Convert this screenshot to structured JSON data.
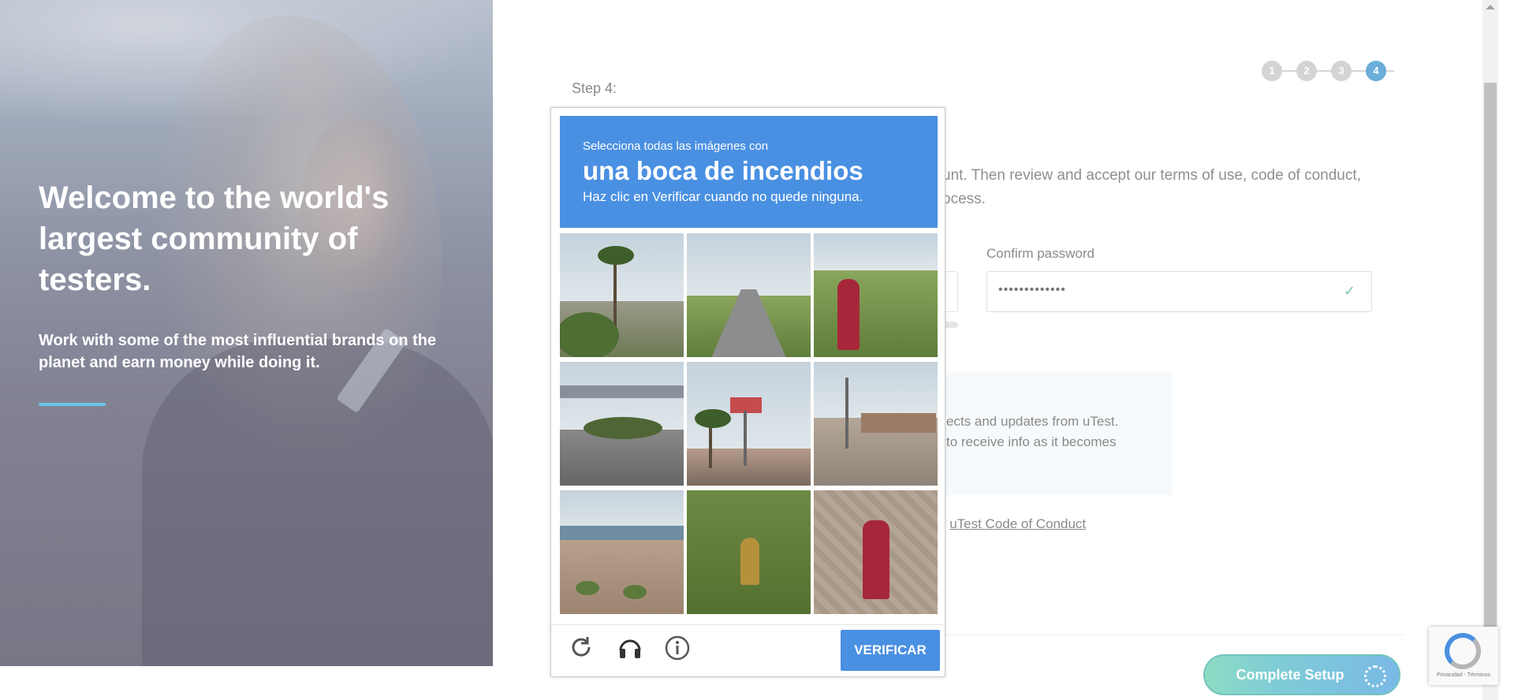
{
  "hero": {
    "heading": "Welcome to the world's largest community of testers.",
    "subtext": "Work with some of the most influential brands on the planet and earn money while doing it."
  },
  "form": {
    "step_label": "Step 4:",
    "steps": [
      "1",
      "2",
      "3",
      "4"
    ],
    "active_step": "4",
    "intro_line1": "unt. Then review and accept our terms of use, code of conduct,",
    "intro_line2": "ocess.",
    "confirm_password_label": "Confirm password",
    "confirm_password_value": "•••••••••••••",
    "newsletter_line1": "ects and updates from uTest.",
    "newsletter_line2": "to receive info as it becomes",
    "conduct_prefix": "e ",
    "conduct_link": "uTest Code of Conduct",
    "complete_button": "Complete Setup"
  },
  "captcha": {
    "instruction_small": "Selecciona todas las imágenes con",
    "instruction_target": "una boca de incendios",
    "instruction_hint": "Haz clic en Verificar cuando no quede ninguna.",
    "tiles": [
      "palm-tree",
      "highway",
      "fire-hydrant",
      "overpass",
      "palm-sign",
      "street-corner",
      "bridge-shrubs",
      "fire-hydrant-field",
      "fire-hydrant-pavement"
    ],
    "reload_icon": "reload-icon",
    "audio_icon": "headphones-icon",
    "info_icon": "info-icon",
    "verify_button": "VERIFICAR"
  },
  "recaptcha_badge": {
    "terms": "Privacidad - Términos"
  },
  "colors": {
    "captcha_blue": "#4a90e2",
    "active_step": "#6aaed9",
    "complete_gradient_start": "#8ddcc2",
    "complete_gradient_end": "#79b9e6"
  }
}
